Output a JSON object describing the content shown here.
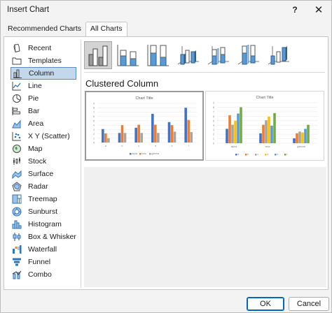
{
  "window": {
    "title": "Insert Chart",
    "help": "?",
    "close": "✕"
  },
  "tabs": [
    {
      "label": "Recommended Charts"
    },
    {
      "label": "All Charts"
    }
  ],
  "chart_types": [
    {
      "label": "Recent"
    },
    {
      "label": "Templates"
    },
    {
      "label": "Column"
    },
    {
      "label": "Line"
    },
    {
      "label": "Pie"
    },
    {
      "label": "Bar"
    },
    {
      "label": "Area"
    },
    {
      "label": "X Y (Scatter)"
    },
    {
      "label": "Map"
    },
    {
      "label": "Stock"
    },
    {
      "label": "Surface"
    },
    {
      "label": "Radar"
    },
    {
      "label": "Treemap"
    },
    {
      "label": "Sunburst"
    },
    {
      "label": "Histogram"
    },
    {
      "label": "Box & Whisker"
    },
    {
      "label": "Waterfall"
    },
    {
      "label": "Funnel"
    },
    {
      "label": "Combo"
    }
  ],
  "selected_type": "Column",
  "subtype_title": "Clustered Column",
  "colors": {
    "series1": "#4472c4",
    "series2": "#ed7d31",
    "series3": "#a5a5a5",
    "series4": "#ffc000",
    "series5": "#5b9bd5",
    "series6": "#70ad47",
    "selection": "#c4d8ed",
    "accent": "#0067c0"
  },
  "previews": [
    {
      "chart_data": {
        "type": "bar",
        "title": "Chart Title",
        "categories": [
          "a",
          "b",
          "c",
          "d",
          "e",
          "f"
        ],
        "series": [
          {
            "name": "alpha",
            "values": [
              3.1,
              2.2,
              3.4,
              6.6,
              4.7,
              8.0
            ]
          },
          {
            "name": "beta",
            "values": [
              2.1,
              4.0,
              4.1,
              4.1,
              4.0,
              5.2
            ]
          },
          {
            "name": "gamma",
            "values": [
              1.0,
              2.2,
              2.2,
              2.2,
              2.5,
              2.4
            ]
          }
        ],
        "ylim": [
          0,
          9
        ],
        "yticks": [
          "0",
          "1",
          "2",
          "3",
          "4",
          "5",
          "6",
          "7",
          "8",
          "9"
        ],
        "legend": "bottom"
      }
    },
    {
      "chart_data": {
        "type": "bar",
        "title": "Chart Title",
        "categories": [
          "alpha",
          "beta",
          "gamma"
        ],
        "series": [
          {
            "name": "a",
            "values": [
              3.2,
              2.2,
              1.1
            ]
          },
          {
            "name": "b",
            "values": [
              6.2,
              4.1,
              2.2
            ]
          },
          {
            "name": "c",
            "values": [
              4.1,
              5.1,
              2.6
            ]
          },
          {
            "name": "d",
            "values": [
              5.0,
              5.9,
              2.4
            ]
          },
          {
            "name": "e",
            "values": [
              6.6,
              3.9,
              3.2
            ]
          },
          {
            "name": "f",
            "values": [
              8.0,
              6.7,
              4.1
            ]
          }
        ],
        "ylim": [
          0,
          9
        ],
        "yticks": [
          "0",
          "1",
          "2",
          "3",
          "4",
          "5",
          "6",
          "7",
          "8",
          "9"
        ],
        "legend": "bottom"
      }
    }
  ],
  "buttons": {
    "ok": "OK",
    "cancel": "Cancel"
  }
}
